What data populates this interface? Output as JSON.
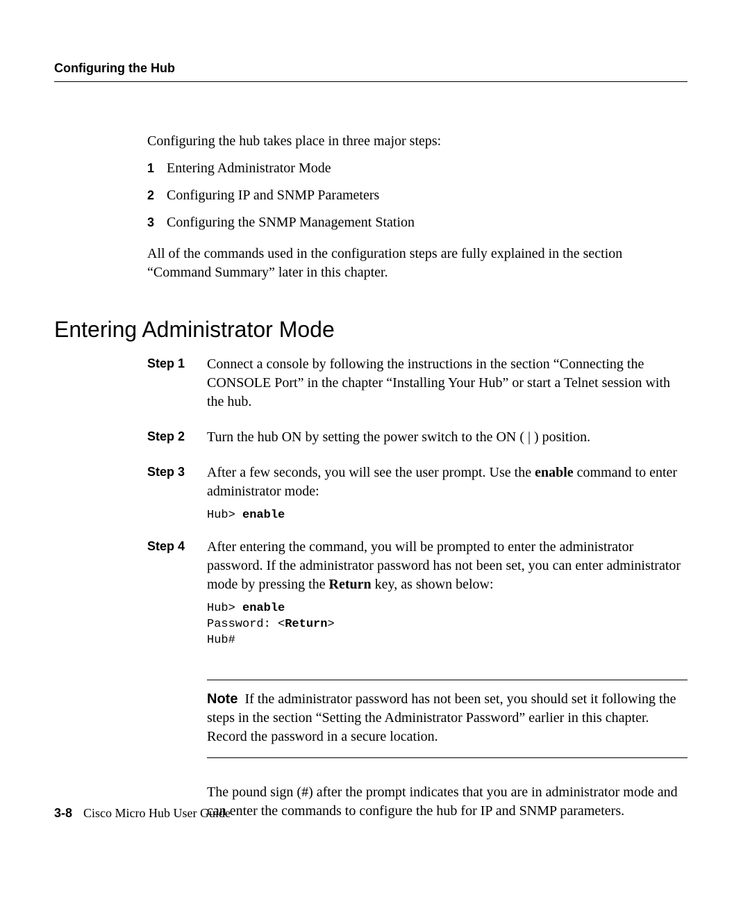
{
  "header": {
    "running_head": "Configuring the Hub"
  },
  "intro": {
    "lead": "Configuring the hub takes place in three major steps:",
    "items": [
      {
        "num": "1",
        "text": "Entering Administrator Mode"
      },
      {
        "num": "2",
        "text": "Configuring IP and SNMP Parameters"
      },
      {
        "num": "3",
        "text": "Configuring the SNMP Management Station"
      }
    ],
    "tail": "All of the commands used in the configuration steps are fully explained in the section “Command Summary” later in this chapter."
  },
  "section": {
    "title": "Entering Administrator Mode"
  },
  "steps": [
    {
      "label": "Step 1",
      "body_pre": "Connect a console by following the instructions in the section “Connecting the CONSOLE Port” in the chapter “Installing Your Hub” or start a Telnet session with the hub."
    },
    {
      "label": "Step 2",
      "body_pre": "Turn the hub ON by setting the power switch to the ON ( | ) position."
    },
    {
      "label": "Step 3",
      "body_pre": "After a few seconds, you will see the user prompt. Use the ",
      "bold1": "enable",
      "body_post": " command to enter administrator mode:",
      "code": {
        "l1_plain": "Hub> ",
        "l1_bold": "enable"
      }
    },
    {
      "label": "Step 4",
      "body_pre": "After entering the command, you will be prompted to enter the administrator password. If the administrator password has not been set, you can enter administrator mode by pressing the ",
      "bold1": "Return",
      "body_post": " key, as shown below:",
      "code": {
        "l1_plain": "Hub> ",
        "l1_bold": "enable",
        "l2_plain": "Password: <",
        "l2_bold": "Return",
        "l2_plain2": ">",
        "l3_plain": "Hub#"
      }
    }
  ],
  "note": {
    "label": "Note",
    "text": "If the administrator password has not been set, you should set it following the steps in the section “Setting the Administrator Password” earlier in this chapter. Record the password in a secure location."
  },
  "closing": "The pound sign (#) after the prompt indicates that you are in administrator mode and can enter the commands to configure the hub for IP and SNMP parameters.",
  "footer": {
    "page": "3-8",
    "title": "Cisco Micro Hub User Guide"
  }
}
